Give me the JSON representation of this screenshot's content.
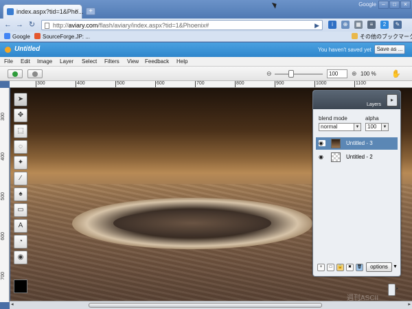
{
  "browser": {
    "tab_title": "index.aspx?tid=1&Pho...",
    "tab_close": "×",
    "new_tab": "+",
    "brand": "Google",
    "win_buttons": [
      "–",
      "□",
      "×"
    ],
    "back": "←",
    "forward": "→",
    "reload": "↻",
    "url_prefix": "http://",
    "url_host": "aviary.com",
    "url_path": "/flash/aviary/index.aspx?tid=1&Phoenix#",
    "go": "▶",
    "ext_icons": [
      "i",
      "⊕",
      "▦",
      "≡",
      "2",
      "✎"
    ]
  },
  "bookmarks": {
    "items": [
      "Google",
      "SourceForge.JP: ..."
    ],
    "other": "その他のブックマーク"
  },
  "app": {
    "document_title": "Untitled",
    "unsaved_message": "You haven't saved yet",
    "save_as": "Save as ..."
  },
  "menu": [
    "File",
    "Edit",
    "Image",
    "Layer",
    "Select",
    "Filters",
    "View",
    "Feedback",
    "Help"
  ],
  "zoom": {
    "slider_fraction": 0.3,
    "value": "100",
    "percent": "100 %"
  },
  "ruler": {
    "h": [
      "300",
      "400",
      "500",
      "600",
      "700",
      "800",
      "900",
      "1000",
      "1100"
    ],
    "v": [
      "300",
      "400",
      "500",
      "600",
      "700"
    ]
  },
  "tools": [
    "➤",
    "✥",
    "⬚",
    "◌",
    "✦",
    "∕",
    "♠",
    "▭",
    "A",
    "◔",
    "◉"
  ],
  "layers": {
    "title": "Layers",
    "blend_label": "blend mode",
    "alpha_label": "alpha",
    "blend_value": "normal",
    "alpha_value": "100",
    "items": [
      {
        "name": "Untitled - 3",
        "selected": true
      },
      {
        "name": "Untitled - 2",
        "selected": false
      }
    ],
    "bottom_icons": [
      "+",
      "□",
      "🔒",
      "✖",
      "🗑"
    ],
    "options": "options"
  },
  "watermark": "週刊ASCII"
}
